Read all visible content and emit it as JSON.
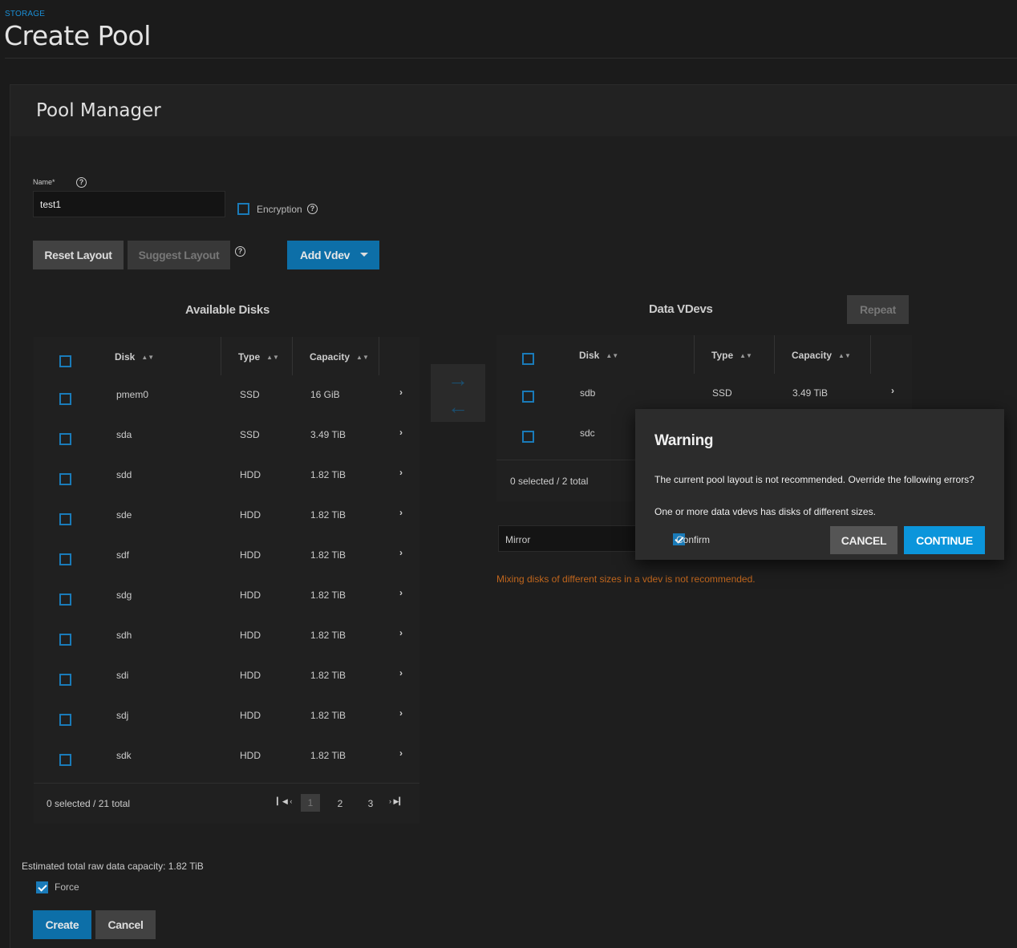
{
  "header": {
    "breadcrumb": "STORAGE",
    "title": "Create Pool"
  },
  "pool_manager": {
    "title": "Pool Manager",
    "name_label": "Name*",
    "name_value": "test1",
    "encryption_label": "Encryption",
    "encryption_checked": false,
    "reset_layout": "Reset Layout",
    "suggest_layout": "Suggest Layout",
    "add_vdev": "Add Vdev"
  },
  "available_disks": {
    "title": "Available Disks",
    "columns": [
      "Disk",
      "Type",
      "Capacity"
    ],
    "rows": [
      {
        "disk": "pmem0",
        "type": "SSD",
        "capacity": "16 GiB"
      },
      {
        "disk": "sda",
        "type": "SSD",
        "capacity": "3.49 TiB"
      },
      {
        "disk": "sdd",
        "type": "HDD",
        "capacity": "1.82 TiB"
      },
      {
        "disk": "sde",
        "type": "HDD",
        "capacity": "1.82 TiB"
      },
      {
        "disk": "sdf",
        "type": "HDD",
        "capacity": "1.82 TiB"
      },
      {
        "disk": "sdg",
        "type": "HDD",
        "capacity": "1.82 TiB"
      },
      {
        "disk": "sdh",
        "type": "HDD",
        "capacity": "1.82 TiB"
      },
      {
        "disk": "sdi",
        "type": "HDD",
        "capacity": "1.82 TiB"
      },
      {
        "disk": "sdj",
        "type": "HDD",
        "capacity": "1.82 TiB"
      },
      {
        "disk": "sdk",
        "type": "HDD",
        "capacity": "1.82 TiB"
      }
    ],
    "footer": "0 selected / 21 total",
    "pages": [
      "1",
      "2",
      "3"
    ],
    "current_page": "1"
  },
  "data_vdevs": {
    "title": "Data VDevs",
    "repeat": "Repeat",
    "columns": [
      "Disk",
      "Type",
      "Capacity"
    ],
    "rows": [
      {
        "disk": "sdb",
        "type": "SSD",
        "capacity": "3.49 TiB"
      },
      {
        "disk": "sdc",
        "type": "",
        "capacity": ""
      }
    ],
    "footer": "0 selected / 2 total",
    "layout": "Mirror",
    "warning": "Mixing disks of different sizes in a vdev is not recommended."
  },
  "footer": {
    "estimated_capacity": "Estimated total raw data capacity: 1.82 TiB",
    "force_label": "Force",
    "force_checked": true,
    "create": "Create",
    "cancel": "Cancel"
  },
  "dialog": {
    "title": "Warning",
    "message": "The current pool layout is not recommended. Override the following errors?",
    "error": "One or more data vdevs has disks of different sizes.",
    "confirm_label": "Confirm",
    "confirm_checked": true,
    "cancel": "CANCEL",
    "continue": "CONTINUE"
  },
  "colors": {
    "accent": "#0d6fa8",
    "dialog_accent": "#0b95db",
    "warning": "#c0661d",
    "background": "#1b1b1b"
  }
}
